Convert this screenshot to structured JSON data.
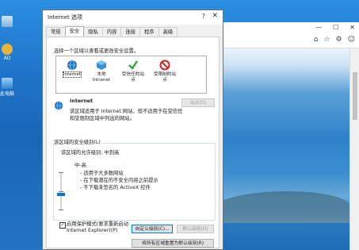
{
  "desktop": {
    "icons": [
      {
        "label": "",
        "icon": "recycle-bin-icon"
      },
      {
        "label": "AD",
        "icon": "app-icon"
      },
      {
        "label": "此电脑",
        "icon": "computer-icon"
      }
    ]
  },
  "ie_window": {
    "controls": [
      "—",
      "☐",
      "✕"
    ],
    "toolbar_icons": [
      "home-icon",
      "star-icon",
      "gear-icon",
      "smiley-icon"
    ]
  },
  "dialog": {
    "title": "Internet 选项",
    "help": "?",
    "close": "✕",
    "tabs": [
      "常规",
      "安全",
      "隐私",
      "内容",
      "连接",
      "程序",
      "高级"
    ],
    "active_tab": "安全",
    "instruction": "选择一个区域以查看或更改安全设置。",
    "zones": [
      {
        "label": "Internet",
        "icon": "globe-icon",
        "color": "#1e73be"
      },
      {
        "label": "本地\nIntranet",
        "icon": "intranet-icon",
        "color": "#3a8fd6"
      },
      {
        "label": "受信任的站\n点",
        "icon": "check-icon",
        "color": "#2fa33b"
      },
      {
        "label": "受限制的站\n点",
        "icon": "prohibited-icon",
        "color": "#d32020"
      }
    ],
    "selected_zone": "Internet",
    "zone_heading": "Internet",
    "zone_desc": "该区域适用于 Internet 网站，但不适用于在受信任\n和受限制区域中列出的网站。",
    "sites_button": "站点(S)",
    "security_level_title": "该区域的安全级别(L)",
    "allowed_levels": "该区域的允许级别: 中到高",
    "level_name": "中-高",
    "level_desc": "- 适用于大多数网站\n- 在下载潜在的不安全内容之前提示\n- 不下载未签名的 ActiveX 控件",
    "protected_mode": "启用保护模式(要求重新启动\nInternet Explorer)(P)",
    "protected_mode_checked": true,
    "custom_level_button": "自定义级别(C)...",
    "default_level_button": "默认级别(D)",
    "reset_all_button": "将所有区域重置为默认级别(R)"
  }
}
